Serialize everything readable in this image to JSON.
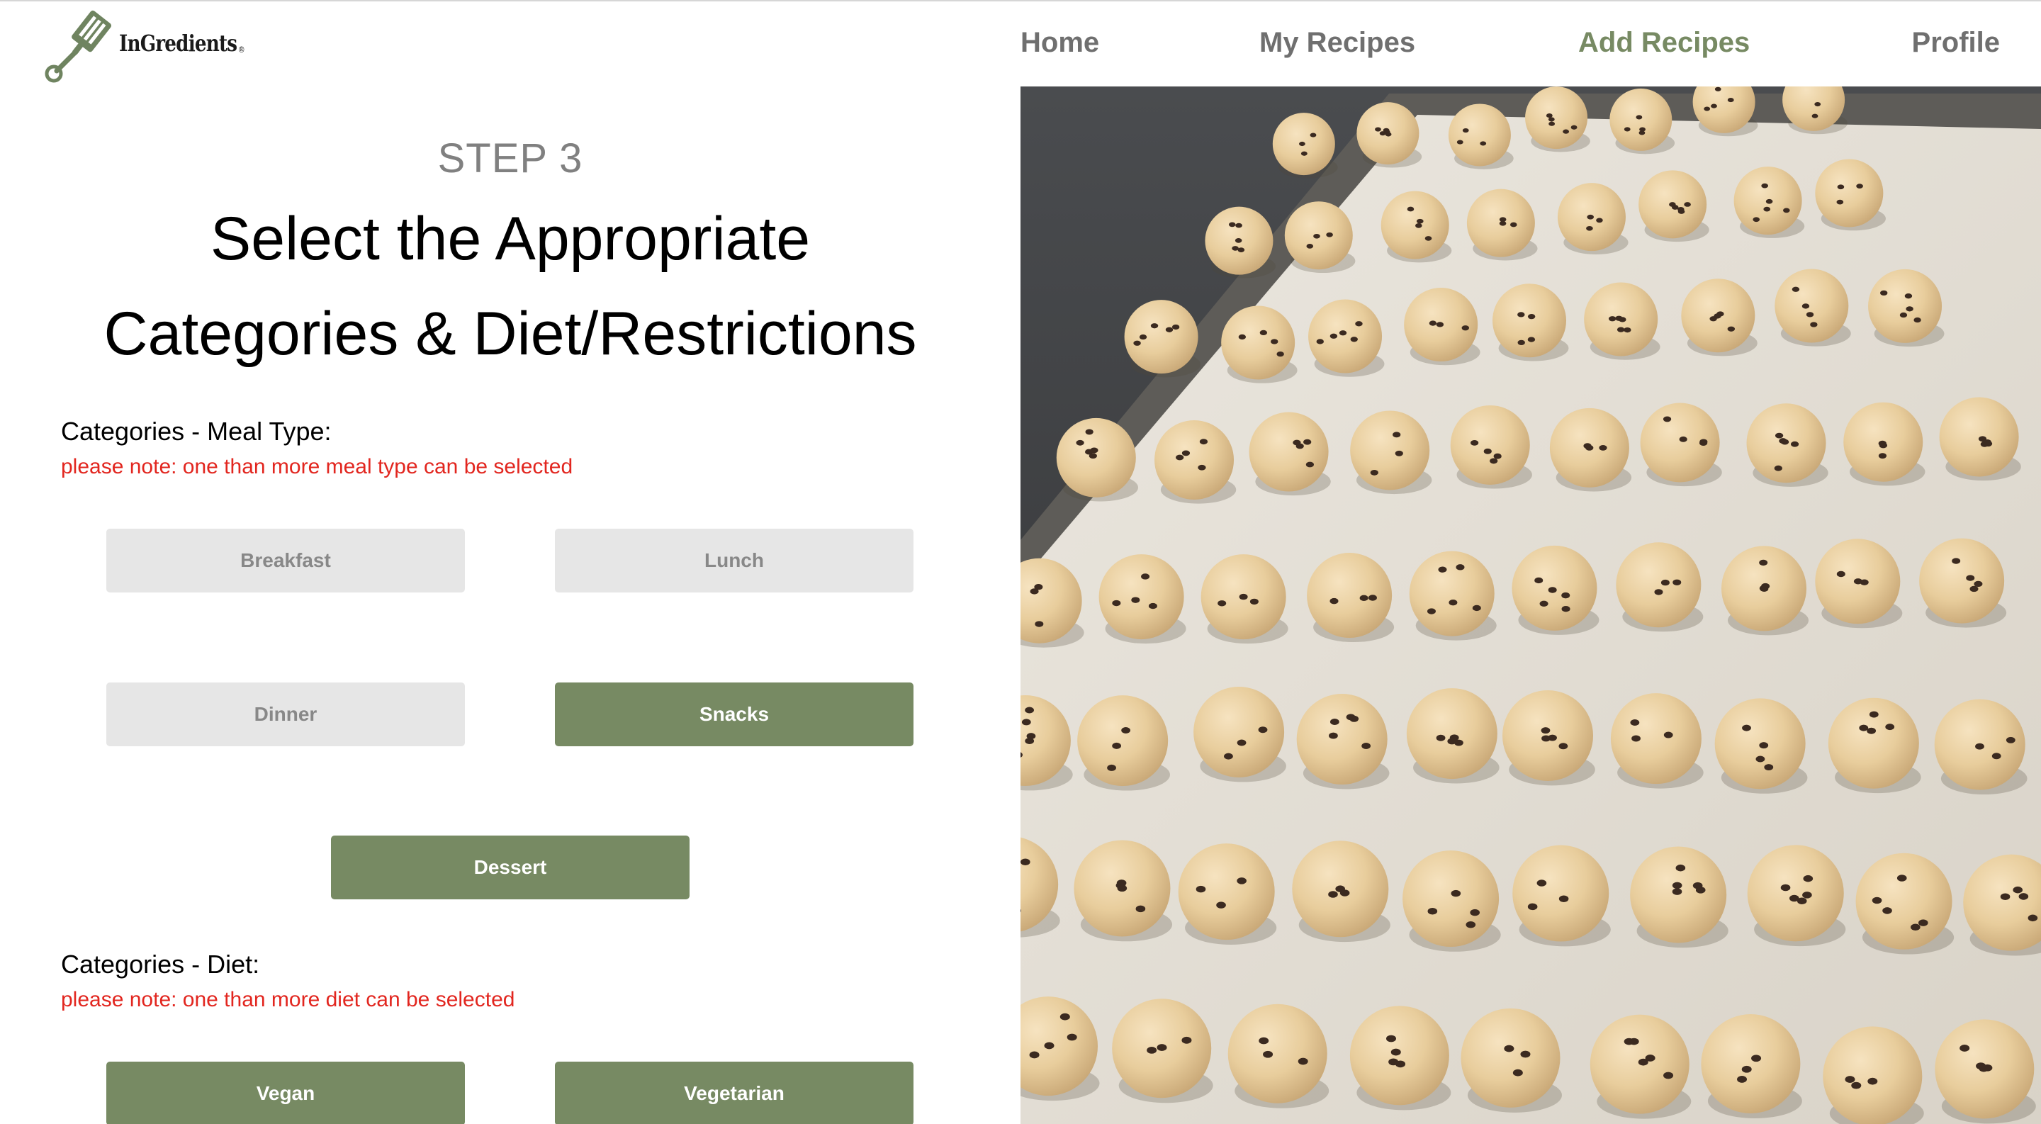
{
  "brand": {
    "name": "InGredients",
    "registered": "®"
  },
  "nav": {
    "items": [
      {
        "label": "Home",
        "active": false
      },
      {
        "label": "My Recipes",
        "active": false
      },
      {
        "label": "Add Recipes",
        "active": true
      },
      {
        "label": "Profile",
        "active": false
      }
    ]
  },
  "step": {
    "label": "STEP 3",
    "title_line_1": "Select the Appropriate",
    "title_line_2": "Categories & Diet/Restrictions"
  },
  "meal_type": {
    "label": "Categories - Meal Type:",
    "note": "please note: one than more meal type can be selected",
    "options": [
      {
        "label": "Breakfast",
        "selected": false
      },
      {
        "label": "Lunch",
        "selected": false
      },
      {
        "label": "Dinner",
        "selected": false
      },
      {
        "label": "Snacks",
        "selected": true
      },
      {
        "label": "Dessert",
        "selected": true
      }
    ]
  },
  "diet": {
    "label": "Categories - Diet:",
    "note": "please note: one than more diet can be selected",
    "options": [
      {
        "label": "Vegan",
        "selected": true
      },
      {
        "label": "Vegetarian",
        "selected": true
      }
    ]
  },
  "colors": {
    "accent": "#778a63",
    "unselected_bg": "#e6e6e6",
    "unselected_text": "#888888",
    "note_red": "#e2261f",
    "nav_text": "#6f6f6f"
  },
  "hero_image": {
    "subject": "tray of raw cookie dough balls"
  }
}
